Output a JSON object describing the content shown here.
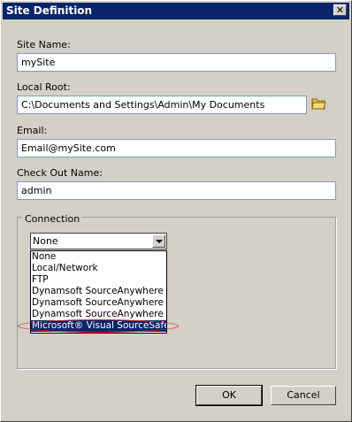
{
  "window": {
    "title": "Site Definition",
    "close_glyph": "✕"
  },
  "fields": {
    "site_name": {
      "label": "Site Name:",
      "value": "mySite"
    },
    "local_root": {
      "label": "Local Root:",
      "value": "C:\\Documents and Settings\\Admin\\My Documents",
      "browse_icon": "folder-icon"
    },
    "email": {
      "label": "Email:",
      "value": "Email@mySite.com"
    },
    "checkout_name": {
      "label": "Check Out Name:",
      "value": "admin"
    }
  },
  "connection": {
    "group_label": "Connection",
    "selected": "None",
    "options": [
      "None",
      "Local/Network",
      "FTP",
      "Dynamsoft SourceAnywhere Ho",
      "Dynamsoft SourceAnywhere St",
      "Dynamsoft SourceAnywhere fo",
      "Microsoft® Visual SourceSafe®"
    ],
    "highlighted_index": 6,
    "annotation_color": "#e02020"
  },
  "buttons": {
    "ok": "OK",
    "cancel": "Cancel"
  },
  "colors": {
    "titlebar": "#0a246a",
    "face": "#d4d0c8",
    "selection": "#0a246a"
  }
}
